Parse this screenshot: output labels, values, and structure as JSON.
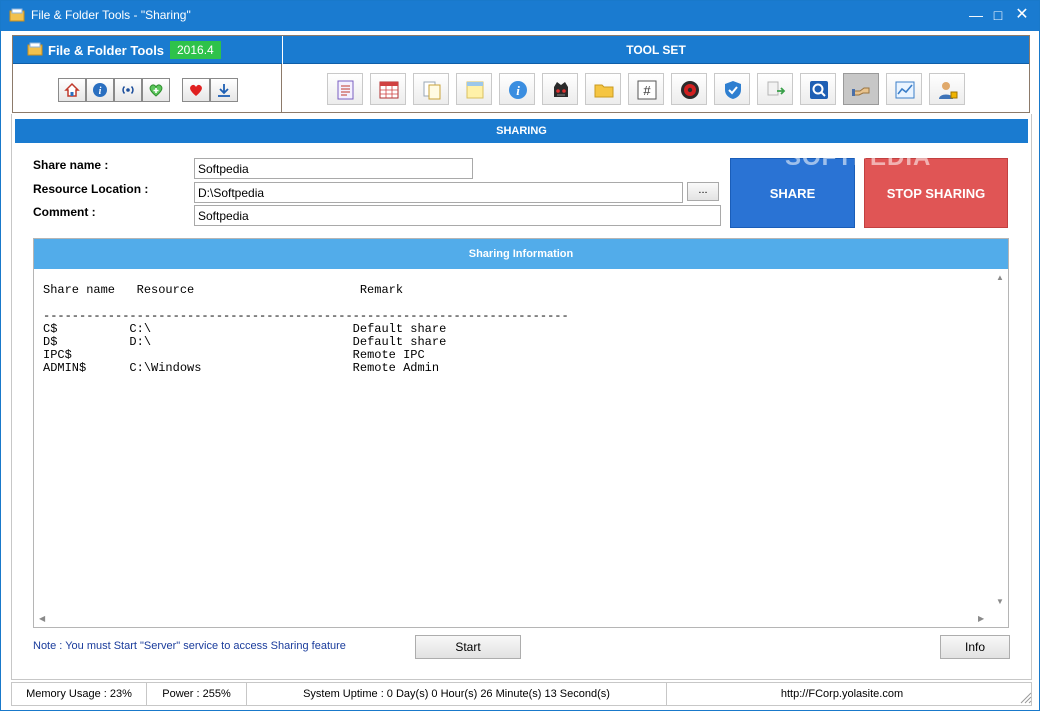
{
  "window": {
    "title": "File & Folder Tools - \"Sharing\""
  },
  "brand": {
    "name": "File & Folder Tools",
    "version": "2016.4"
  },
  "mini_buttons": [
    "home-icon",
    "info-icon",
    "broadcast-icon",
    "health-plus-icon",
    "heart-icon",
    "download-icon"
  ],
  "toolset": {
    "title": "TOOL SET",
    "tools": [
      "file-list-icon",
      "calendar-grid-icon",
      "copy-documents-icon",
      "sticky-note-icon",
      "info-circle-icon",
      "robot-icon",
      "folder-icon",
      "hash-icon",
      "gear-red-icon",
      "shield-check-icon",
      "file-convert-icon",
      "search-icon",
      "sharing-hand-icon",
      "chart-icon",
      "user-lock-icon"
    ],
    "active_tool": "sharing-hand-icon"
  },
  "sharing": {
    "section_title": "SHARING",
    "share_name_label": "Share name :",
    "share_name_value": "Softpedia",
    "resource_location_label": "Resource Location :",
    "resource_location_value": "D:\\Softpedia",
    "browse_label": "...",
    "comment_label": "Comment :",
    "comment_value": "Softpedia",
    "share_button": "SHARE",
    "stop_button": "STOP SHARING",
    "watermark": "SOFTPEDIA"
  },
  "info": {
    "title": "Sharing Information",
    "header_line": "Share name   Resource                       Remark",
    "separator": "-------------------------------------------------------------------------",
    "rows": [
      {
        "name": "C$",
        "resource": "C:\\",
        "remark": "Default share"
      },
      {
        "name": "D$",
        "resource": "D:\\",
        "remark": "Default share"
      },
      {
        "name": "IPC$",
        "resource": "",
        "remark": "Remote IPC"
      },
      {
        "name": "ADMIN$",
        "resource": "C:\\Windows",
        "remark": "Remote Admin"
      }
    ]
  },
  "note": "Note : You must Start \"Server\" service to access Sharing feature",
  "start_button": "Start",
  "info_button": "Info",
  "status": {
    "memory": "Memory Usage : 23%",
    "power": "Power : 255%",
    "uptime": "System Uptime : 0 Day(s) 0 Hour(s) 26 Minute(s) 13 Second(s)",
    "url": "http://FCorp.yolasite.com"
  }
}
